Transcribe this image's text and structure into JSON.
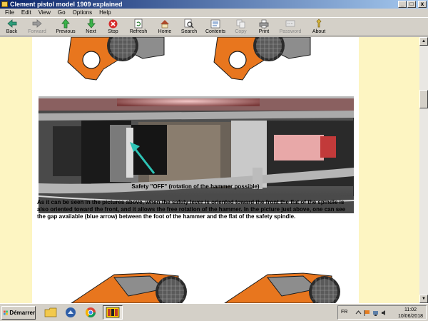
{
  "window": {
    "title": "Clement pistol model 1909 explained"
  },
  "window_controls": {
    "minimize": "_",
    "maximize": "□",
    "close": "x"
  },
  "menu": [
    "File",
    "Edit",
    "View",
    "Go",
    "Options",
    "Help"
  ],
  "toolbar": {
    "back": "Back",
    "forward": "Forward",
    "previous": "Previous",
    "next": "Next",
    "stop": "Stop",
    "refresh": "Refresh",
    "home": "Home",
    "search": "Search",
    "contents": "Contents",
    "copy": "Copy",
    "print": "Print",
    "password": "Password",
    "about": "About"
  },
  "page": {
    "caption": "Safety \"OFF\" (rotation of the hammer possible)",
    "paragraph": "As it can be seen in the pictures above, when the safety lever is oriented toward the front the flat of the spindle is also oriented toward the front, and it allows the free rotation of the hammer. In the picture just above, one can see the gap available (blue arrow) between the foot of the hammer and the flat of the safety spindle."
  },
  "taskbar": {
    "start_label": "Démarrer",
    "language": "FR",
    "time": "11:02",
    "date": "10/06/2018"
  },
  "colors": {
    "page_bg": "#fdf5c2",
    "arrow": "#2ec4b6",
    "orange_part": "#e8761e"
  }
}
